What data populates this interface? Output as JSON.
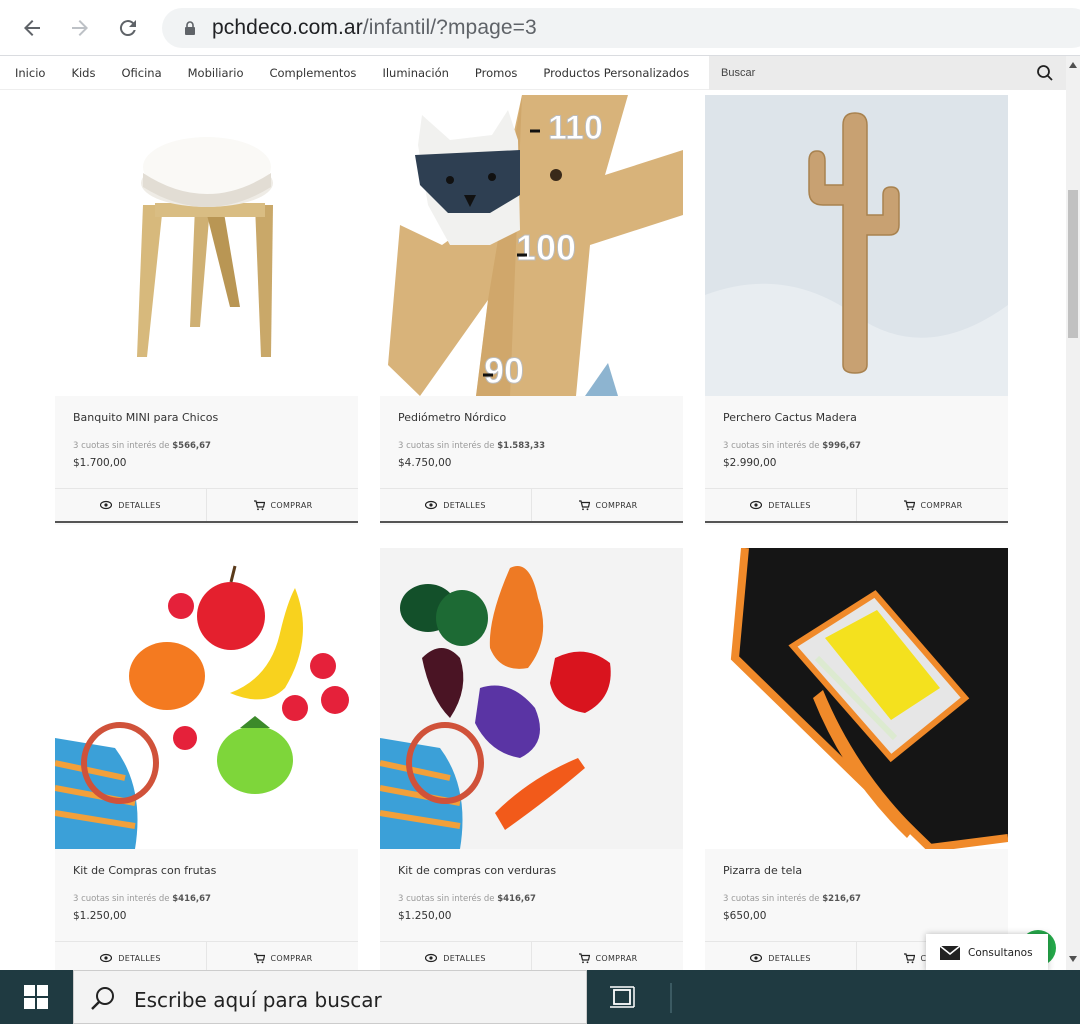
{
  "browser": {
    "url_host": "pchdeco.com.ar",
    "url_path": "/infantil/?mpage=3"
  },
  "site_nav": {
    "menu": [
      "Inicio",
      "Kids",
      "Oficina",
      "Mobiliario",
      "Complementos",
      "Iluminación",
      "Promos",
      "Productos Personalizados"
    ],
    "search_placeholder": "Buscar"
  },
  "products": [
    {
      "title": "Banquito MINI para Chicos",
      "cuotas_prefix": "3 cuotas sin interés de",
      "cuota": "$566,67",
      "price": "$1.700,00",
      "image": "stool"
    },
    {
      "title": "Pediómetro Nórdico",
      "cuotas_prefix": "3 cuotas sin interés de",
      "cuota": "$1.583,33",
      "price": "$4.750,00",
      "image": "height-chart"
    },
    {
      "title": "Perchero Cactus Madera",
      "cuotas_prefix": "3 cuotas sin interés de",
      "cuota": "$996,67",
      "price": "$2.990,00",
      "image": "cactus"
    },
    {
      "title": "Kit de Compras con frutas",
      "cuotas_prefix": "3 cuotas sin interés de",
      "cuota": "$416,67",
      "price": "$1.250,00",
      "image": "fruits"
    },
    {
      "title": "Kit de compras con verduras",
      "cuotas_prefix": "3 cuotas sin interés de",
      "cuota": "$416,67",
      "price": "$1.250,00",
      "image": "vegetables"
    },
    {
      "title": "Pizarra de tela",
      "cuotas_prefix": "3 cuotas sin interés de",
      "cuota": "$216,67",
      "price": "$650,00",
      "image": "chalkboard"
    }
  ],
  "actions": {
    "details": "DETALLES",
    "buy": "COMPRAR"
  },
  "chat": {
    "label": "Consultanos"
  },
  "taskbar": {
    "search_text": "Escribe aquí para buscar"
  }
}
